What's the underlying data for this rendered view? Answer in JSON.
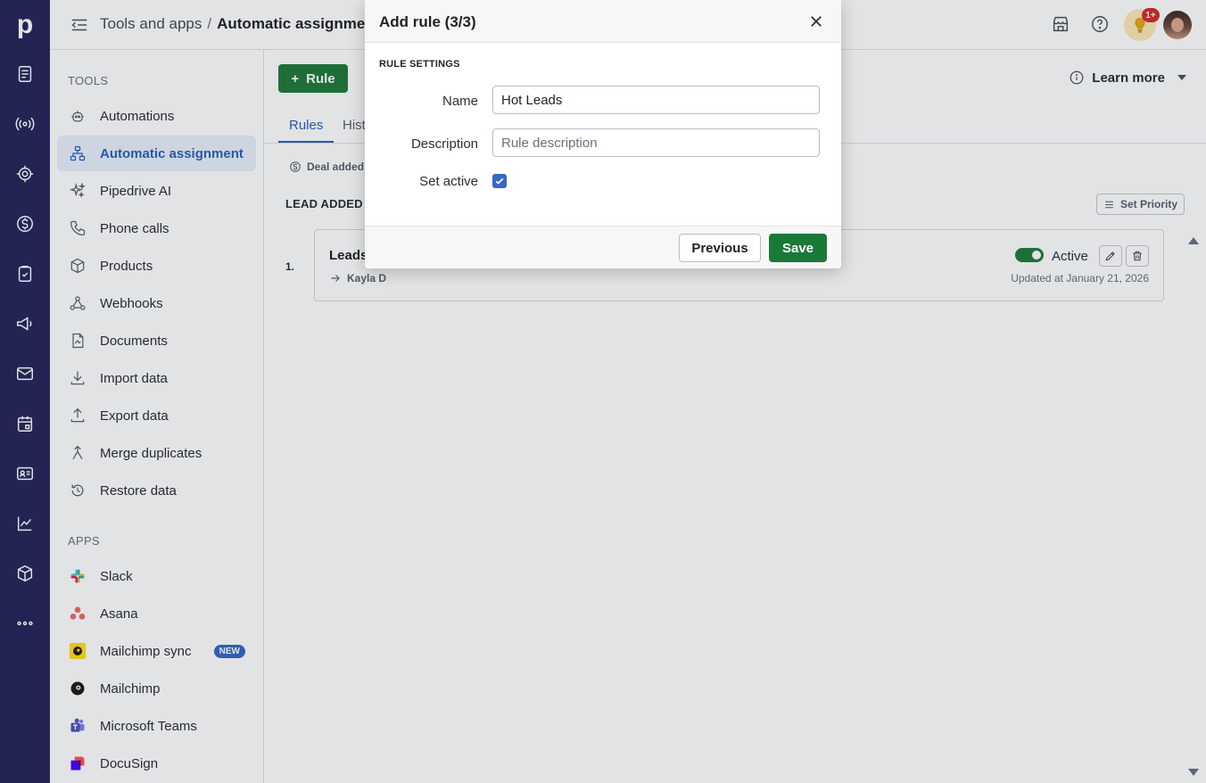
{
  "brand": {
    "logo_letter": "p"
  },
  "rail": {
    "icons": [
      "leads-icon",
      "deals-icon",
      "insights-icon",
      "revenue-icon",
      "activities-icon",
      "campaigns-icon",
      "mail-icon",
      "calendar-icon",
      "contacts-icon",
      "reports-icon",
      "products-icon",
      "more-icon"
    ]
  },
  "header": {
    "breadcrumb_parent": "Tools and apps",
    "breadcrumb_separator": "/",
    "breadcrumb_current": "Automatic assignmer",
    "notifications_badge": "1+"
  },
  "sidebar": {
    "tools_title": "TOOLS",
    "tools": [
      {
        "label": "Automations",
        "icon": "robot-icon"
      },
      {
        "label": "Automatic assignment",
        "icon": "assignment-icon",
        "active": true
      },
      {
        "label": "Pipedrive AI",
        "icon": "sparkle-icon"
      },
      {
        "label": "Phone calls",
        "icon": "phone-icon"
      },
      {
        "label": "Products",
        "icon": "box-icon"
      },
      {
        "label": "Webhooks",
        "icon": "webhook-icon"
      },
      {
        "label": "Documents",
        "icon": "document-icon"
      },
      {
        "label": "Import data",
        "icon": "download-icon"
      },
      {
        "label": "Export data",
        "icon": "upload-icon"
      },
      {
        "label": "Merge duplicates",
        "icon": "merge-icon"
      },
      {
        "label": "Restore data",
        "icon": "restore-icon"
      }
    ],
    "apps_title": "APPS",
    "apps": [
      {
        "label": "Slack",
        "icon": "slack-icon"
      },
      {
        "label": "Asana",
        "icon": "asana-icon"
      },
      {
        "label": "Mailchimp sync",
        "icon": "mailchimp-icon",
        "badge": "NEW"
      },
      {
        "label": "Mailchimp",
        "icon": "mailchimp-icon"
      },
      {
        "label": "Microsoft Teams",
        "icon": "teams-icon"
      },
      {
        "label": "DocuSign",
        "icon": "docusign-icon"
      }
    ]
  },
  "main": {
    "add_rule_label": "Rule",
    "learn_more_label": "Learn more",
    "tabs": [
      "Rules",
      "Hist"
    ],
    "filter_chip": "Deal added",
    "group_title": "LEAD ADDED",
    "set_priority_label": "Set Priority",
    "rules": [
      {
        "index": "1.",
        "name": "Leads",
        "assignee": "Kayla D",
        "status": "Active",
        "updated": "Updated at January 21, 2026"
      }
    ]
  },
  "modal": {
    "title": "Add rule (3/3)",
    "section_title": "RULE SETTINGS",
    "name_label": "Name",
    "name_value": "Hot Leads",
    "description_label": "Description",
    "description_placeholder": "Rule description",
    "set_active_label": "Set active",
    "set_active_checked": true,
    "previous_label": "Previous",
    "save_label": "Save"
  },
  "colors": {
    "rail_bg": "#26265c",
    "primary_green": "#217a3c",
    "accent_blue": "#2a62b8",
    "badge_red": "#d62b2b"
  }
}
